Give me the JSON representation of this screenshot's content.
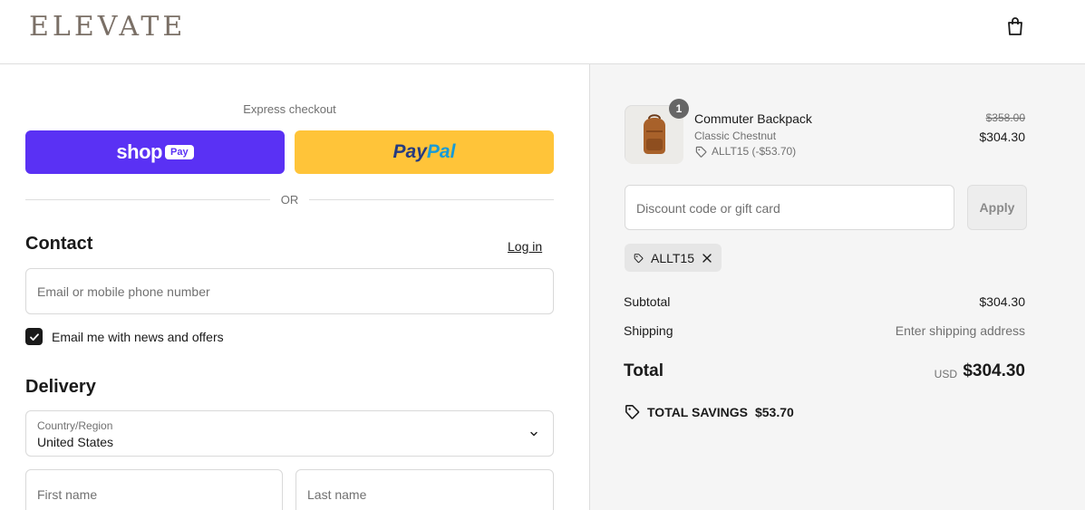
{
  "header": {
    "brand": "ELEVATE",
    "cart_icon": "shopping-bag-icon"
  },
  "express": {
    "label": "Express checkout",
    "shop_pay": {
      "word": "shop",
      "badge": "Pay",
      "color": "#5a31f4"
    },
    "paypal": {
      "part1": "Pay",
      "part2": "Pal",
      "color": "#ffc439"
    },
    "divider": "OR"
  },
  "contact": {
    "title": "Contact",
    "login_link": "Log in",
    "email_placeholder": "Email or mobile phone number",
    "newsletter_label": "Email me with news and offers",
    "newsletter_checked": true
  },
  "delivery": {
    "title": "Delivery",
    "country_label": "Country/Region",
    "country_value": "United States",
    "first_name_placeholder": "First name",
    "last_name_placeholder": "Last name"
  },
  "order": {
    "item": {
      "quantity": "1",
      "name": "Commuter Backpack",
      "variant": "Classic Chestnut",
      "discount": "ALLT15 (-$53.70)",
      "original_price": "$358.00",
      "price": "$304.30"
    },
    "discount_placeholder": "Discount code or gift card",
    "apply_label": "Apply",
    "applied_code": "ALLT15",
    "subtotal_label": "Subtotal",
    "subtotal_value": "$304.30",
    "shipping_label": "Shipping",
    "shipping_value": "Enter shipping address",
    "total_label": "Total",
    "currency": "USD",
    "total_value": "$304.30",
    "savings_label": "TOTAL SAVINGS",
    "savings_value": "$53.70"
  }
}
